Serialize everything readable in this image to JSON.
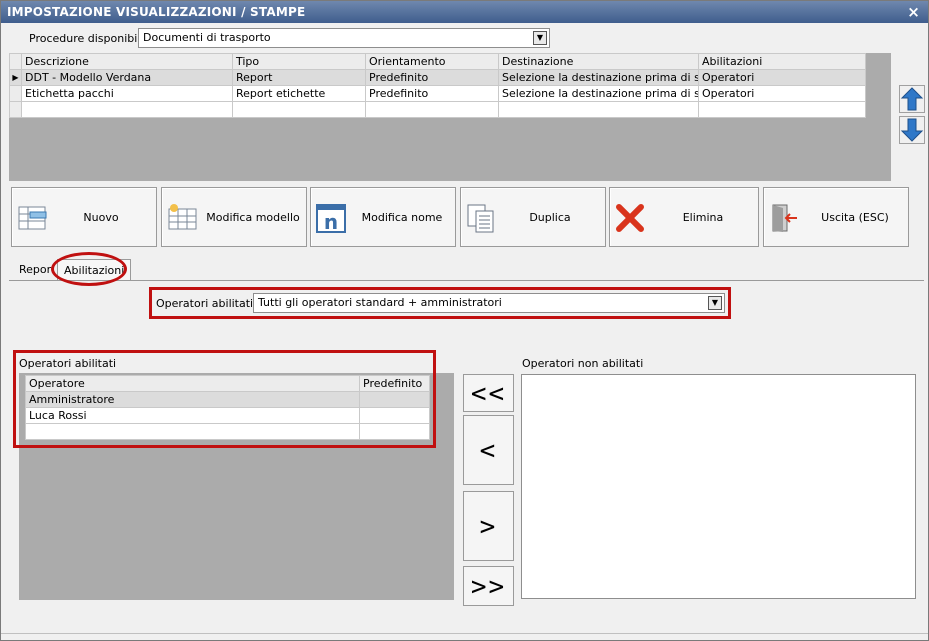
{
  "window": {
    "title": "IMPOSTAZIONE VISUALIZZAZIONI / STAMPE",
    "close_glyph": "×"
  },
  "procedure": {
    "label": "Procedure disponibili :",
    "selected": "Documenti di trasporto"
  },
  "grid": {
    "columns": [
      "Descrizione",
      "Tipo",
      "Orientamento",
      "Destinazione",
      "Abilitazioni"
    ],
    "rows": [
      {
        "descrizione": "DDT - Modello Verdana",
        "tipo": "Report",
        "orientamento": "Predefinito",
        "destinazione": "Selezione la destinazione prima di sta...",
        "abilitazioni": "Operatori",
        "selected": true
      },
      {
        "descrizione": "Etichetta pacchi",
        "tipo": "Report etichette",
        "orientamento": "Predefinito",
        "destinazione": "Selezione la destinazione prima di sta...",
        "abilitazioni": "Operatori",
        "selected": false
      }
    ],
    "row_indicator": "▶"
  },
  "toolbar": {
    "nuovo": "Nuovo",
    "modifica_modello": "Modifica modello",
    "modifica_nome": "Modifica nome",
    "duplica": "Duplica",
    "elimina": "Elimina",
    "uscita": "Uscita (ESC)"
  },
  "tabs": {
    "report": "Repor",
    "abilitazioni": "Abilitazioni"
  },
  "abilitazioni": {
    "label": "Operatori abilitati :",
    "selected": "Tutti gli operatori standard + amministratori"
  },
  "enabled_section": {
    "title": "Operatori abilitati",
    "columns": [
      "Operatore",
      "Predefinito"
    ],
    "rows": [
      {
        "operatore": "Amministratore",
        "predefinito": ""
      },
      {
        "operatore": "Luca Rossi",
        "predefinito": ""
      }
    ]
  },
  "disabled_section": {
    "title": "Operatori non abilitati"
  },
  "move_buttons": {
    "all_left": "<<",
    "left": "<",
    "right": ">",
    "all_right": ">>"
  },
  "colors": {
    "titlebar": "#3f5d8d",
    "highlight": "#c01010",
    "arrow_blue": "#2f78c8"
  }
}
